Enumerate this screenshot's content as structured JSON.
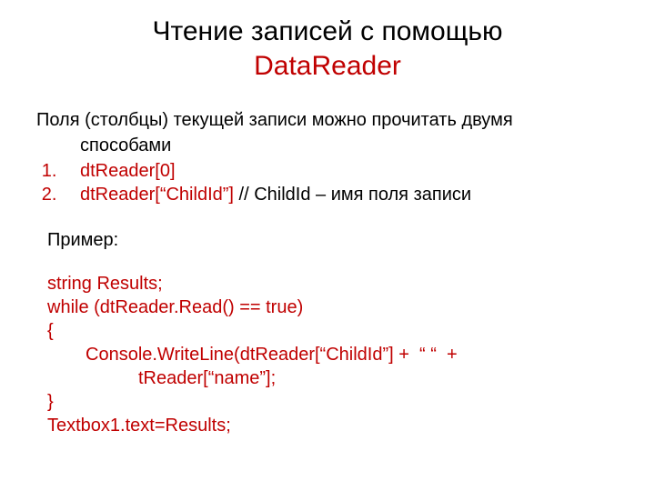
{
  "title": {
    "line1": "Чтение записей с помощью",
    "line2_accent": "DataReader"
  },
  "intro": {
    "line1": "Поля (столбцы) текущей записи можно прочитать двумя",
    "line2": "способами"
  },
  "ways": {
    "item1": "dtReader[0]",
    "item2_code": "dtReader[“ChildId”]  ",
    "item2_comment": "// ChildId – имя поля записи"
  },
  "example_label": "Пример:",
  "code": {
    "l1": "string Results;",
    "l2": "while (dtReader.Read() == true)",
    "l3": "{",
    "l4": "Console.WriteLine(dtReader[“ChildId”] +  “ “  +",
    "l5": "tReader[“name”];",
    "l6": "}",
    "l7": "Textbox1.text=Results;"
  }
}
